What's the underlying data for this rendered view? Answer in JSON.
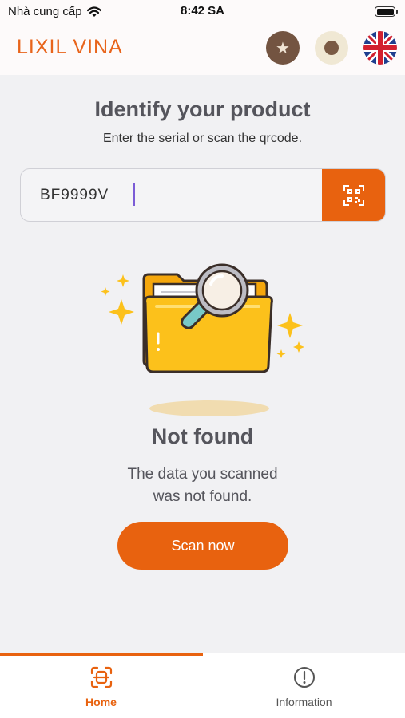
{
  "status_bar": {
    "carrier": "Nhà cung cấp",
    "time": "8:42 SA"
  },
  "header": {
    "title": "LIXIL VINA",
    "favorite_icon": "star-icon",
    "profile_icon": "dot-icon",
    "language_icon": "uk-flag-icon"
  },
  "main": {
    "headline": "Identify your product",
    "subheadline": "Enter the serial or scan the qrcode.",
    "serial_value": "BF9999V",
    "scan_icon": "qr-scan-icon"
  },
  "result": {
    "title": "Not found",
    "message_line1": "The data you scanned",
    "message_line2": "was not found.",
    "scan_button": "Scan now"
  },
  "tabs": [
    {
      "label": "Home",
      "icon": "scan-frame-icon",
      "active": true
    },
    {
      "label": "Information",
      "icon": "info-circle-icon",
      "active": false
    }
  ],
  "colors": {
    "accent": "#e8620f",
    "title_orange": "#e8641b",
    "folder_yellow": "#fcc11b"
  }
}
